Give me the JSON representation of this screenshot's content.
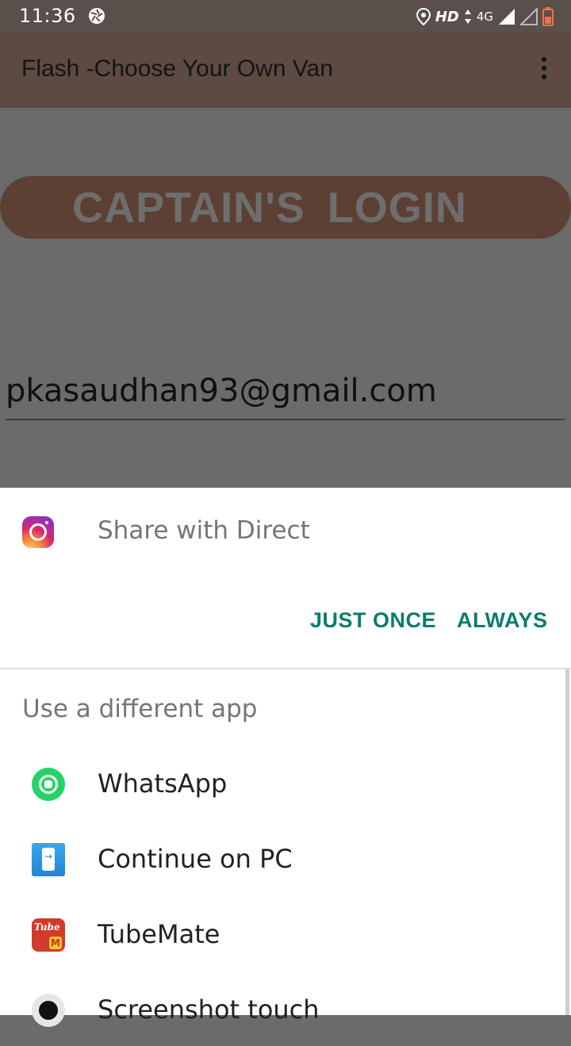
{
  "status_bar": {
    "time": "11:36",
    "hd_label": "HD",
    "network_label": "4G",
    "icons": [
      "aperture-icon",
      "location-icon",
      "data-arrows-icon",
      "signal-icon",
      "signal-empty-icon",
      "battery-low-icon"
    ]
  },
  "app_bar": {
    "title": "Flash -Choose Your Own Van",
    "menu_icon": "overflow-menu-icon"
  },
  "content": {
    "login_banner": "CAPTAIN'S  LOGIN",
    "email_value": "pkasaudhan93@gmail.com"
  },
  "chooser": {
    "default_app_icon": "instagram-icon",
    "default_label": "Share with Direct",
    "just_once_label": "JUST ONCE",
    "always_label": "ALWAYS",
    "different_app_title": "Use a different app",
    "apps": [
      {
        "label": "WhatsApp",
        "icon": "whatsapp-icon"
      },
      {
        "label": "Continue on PC",
        "icon": "continue-on-pc-icon"
      },
      {
        "label": "TubeMate",
        "icon": "tubemate-icon"
      },
      {
        "label": "Screenshot touch",
        "icon": "screenshot-touch-icon"
      }
    ]
  },
  "colors": {
    "accent": "#0b7c6d",
    "app_bar": "#5c4a43",
    "scrim": "#6b6b6b",
    "login_pill": "#5c4033"
  }
}
